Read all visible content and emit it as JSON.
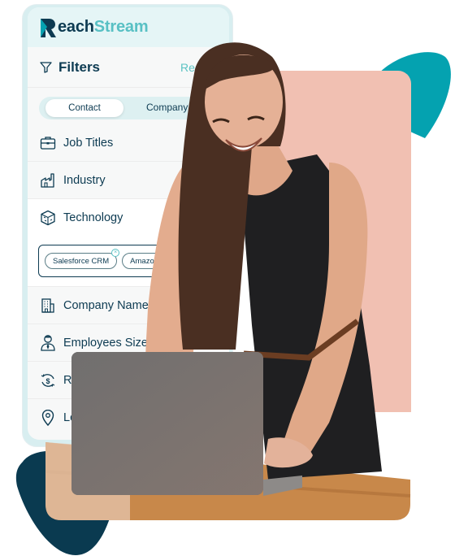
{
  "brand": {
    "name_part1": "each",
    "name_part2": "Stream",
    "logo_letter": "R",
    "colors": {
      "navy": "#0d3b52",
      "teal": "#58c0c4",
      "teal_blob": "#04a2b0",
      "navy_blob": "#0a3a50",
      "peach": "#f1c0b2"
    }
  },
  "filters": {
    "title": "Filters",
    "reset_label": "Re",
    "toggle": {
      "options": [
        "Contact",
        "Company"
      ],
      "selected": "Contact"
    },
    "items": [
      {
        "label": "Job Titles",
        "icon": "briefcase-icon"
      },
      {
        "label": "Industry",
        "icon": "factory-icon"
      },
      {
        "label": "Technology",
        "icon": "cube-icon"
      },
      {
        "label": "Company Name",
        "icon": "building-icon"
      },
      {
        "label": "Employees Size",
        "icon": "employee-icon"
      },
      {
        "label": "Re",
        "icon": "revenue-icon"
      },
      {
        "label": "Lo",
        "icon": "location-pin-icon"
      }
    ],
    "technology_chips": [
      "Salesforce CRM",
      "Amazo"
    ],
    "chip_remove_glyph": "×"
  }
}
